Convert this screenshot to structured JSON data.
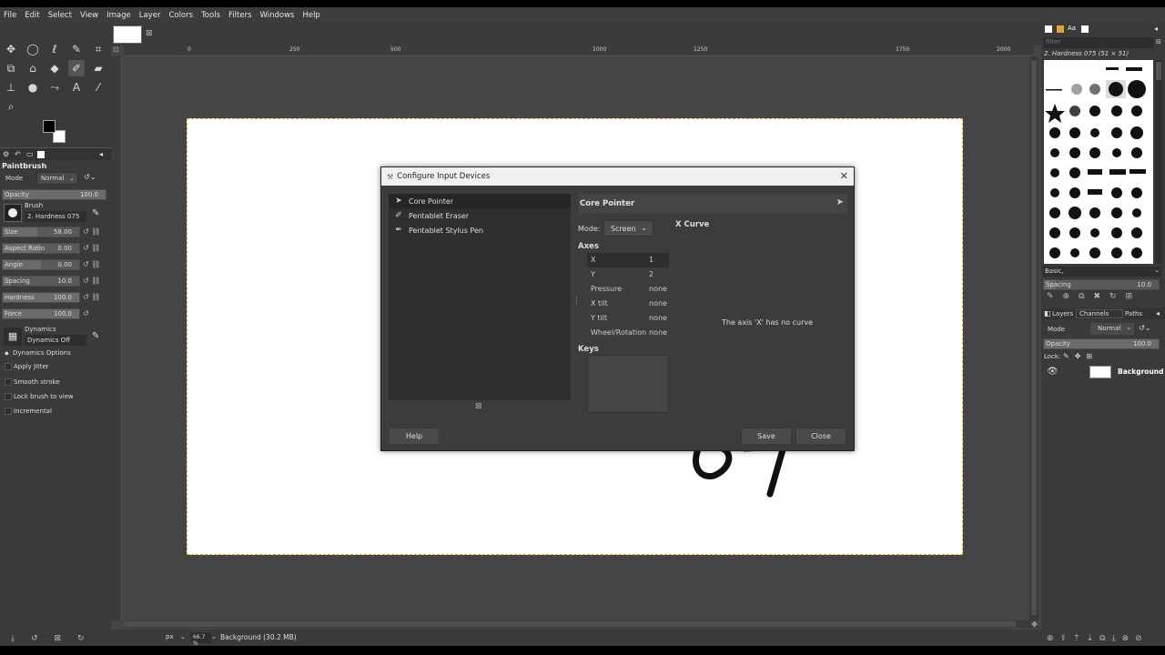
{
  "menubar": {
    "items": [
      "File",
      "Edit",
      "Select",
      "View",
      "Image",
      "Layer",
      "Colors",
      "Tools",
      "Filters",
      "Windows",
      "Help"
    ]
  },
  "toolbox": {
    "tool_icons": [
      "move-icon",
      "ellipse-select-icon",
      "lasso-icon",
      "fuzzy-select-icon",
      "crop-icon",
      "transform-icon",
      "warp-icon",
      "bucket-fill-icon",
      "paintbrush-icon",
      "eraser-icon",
      "clone-icon",
      "smudge-icon",
      "paths-icon",
      "text-icon",
      "color-picker-icon",
      "zoom-icon"
    ],
    "tool_options": {
      "title": "Paintbrush",
      "mode_label": "Mode",
      "mode_value": "Normal",
      "opacity_label": "Opacity",
      "opacity_value": "100.0",
      "brush_label": "Brush",
      "brush_value": "2. Hardness 075",
      "sliders": [
        {
          "label": "Size",
          "value": "58.00",
          "fill": 0.45
        },
        {
          "label": "Aspect Ratio",
          "value": "0.00",
          "fill": 0.5
        },
        {
          "label": "Angle",
          "value": "0.00",
          "fill": 0.5
        },
        {
          "label": "Spacing",
          "value": "10.0",
          "fill": 0.1
        },
        {
          "label": "Hardness",
          "value": "100.0",
          "fill": 1.0
        },
        {
          "label": "Force",
          "value": "100.0",
          "fill": 1.0
        }
      ],
      "dynamics_label": "Dynamics",
      "dynamics_value": "Dynamics Off",
      "dynamics_options": "Dynamics Options",
      "checkboxes": [
        "Apply Jitter",
        "Smooth stroke",
        "Lock brush to view",
        "Incremental"
      ]
    }
  },
  "rulers": {
    "h_ticks": [
      "0",
      "250",
      "500",
      "1000",
      "1250",
      "1750",
      "2000"
    ],
    "v_ticks": [
      "2",
      "5",
      "0",
      "2",
      "5",
      "0",
      "7",
      "5",
      "0"
    ]
  },
  "statusbar": {
    "unit": "px",
    "zoom": "66.7 %",
    "info": "Background (30.2 MB)"
  },
  "right_dock": {
    "filter_placeholder": "filter",
    "brush_name": "2. Hardness 075 (51 × 51)",
    "brush_tag": "Basic,",
    "spacing_label": "Spacing",
    "spacing_value": "10.0",
    "tabs": [
      "Layers",
      "Channels",
      "Paths"
    ],
    "mode_label": "Mode",
    "mode_value": "Normal",
    "opacity_label": "Opacity",
    "opacity_value": "100.0",
    "lock_label": "Lock:",
    "layer_name": "Background"
  },
  "dialog": {
    "title": "Configure Input Devices",
    "devices": [
      {
        "name": "Core Pointer",
        "icon": "pointer-icon",
        "selected": true
      },
      {
        "name": "Pentablet  Eraser",
        "icon": "eraser-icon",
        "selected": false
      },
      {
        "name": "Pentablet  Stylus Pen",
        "icon": "pen-icon",
        "selected": false
      }
    ],
    "device_header": "Core Pointer",
    "mode_label": "Mode:",
    "mode_value": "Screen",
    "axes_label": "Axes",
    "axes": [
      {
        "name": "X",
        "value": "1"
      },
      {
        "name": "Y",
        "value": "2"
      },
      {
        "name": "Pressure",
        "value": "none"
      },
      {
        "name": "X tilt",
        "value": "none"
      },
      {
        "name": "Y tilt",
        "value": "none"
      },
      {
        "name": "Wheel/Rotation",
        "value": "none"
      }
    ],
    "keys_label": "Keys",
    "curve_label": "X Curve",
    "curve_message": "The axis 'X' has no curve",
    "help_label": "Help",
    "save_label": "Save",
    "close_label": "Close"
  }
}
